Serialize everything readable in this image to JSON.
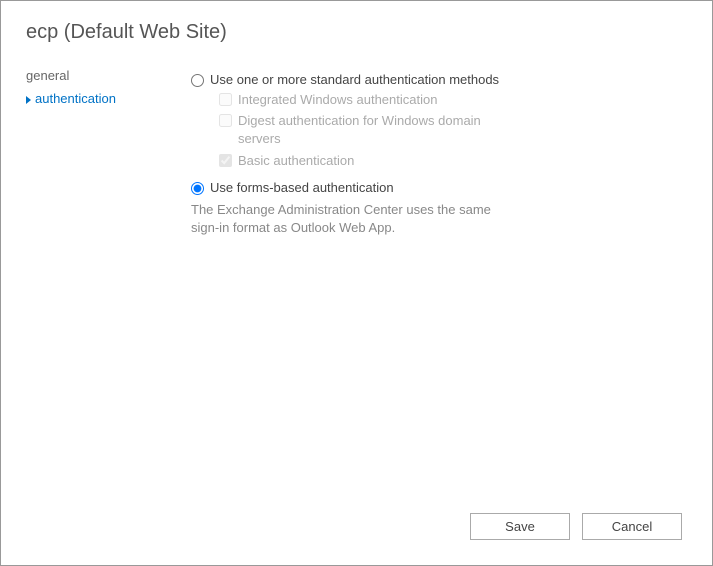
{
  "header": {
    "title": "ecp (Default Web Site)"
  },
  "sidebar": {
    "items": [
      {
        "label": "general",
        "active": false
      },
      {
        "label": "authentication",
        "active": true
      }
    ]
  },
  "main": {
    "standard_auth": {
      "label": "Use one or more standard authentication methods",
      "options": [
        {
          "label": "Integrated Windows authentication",
          "checked": false,
          "disabled": true
        },
        {
          "label": "Digest authentication for Windows domain servers",
          "checked": false,
          "disabled": true
        },
        {
          "label": "Basic authentication",
          "checked": true,
          "disabled": true
        }
      ]
    },
    "forms_auth": {
      "label": "Use forms-based authentication",
      "help": "The Exchange Administration Center uses the same sign-in format as Outlook Web App."
    },
    "selected": "forms"
  },
  "footer": {
    "save_label": "Save",
    "cancel_label": "Cancel"
  }
}
